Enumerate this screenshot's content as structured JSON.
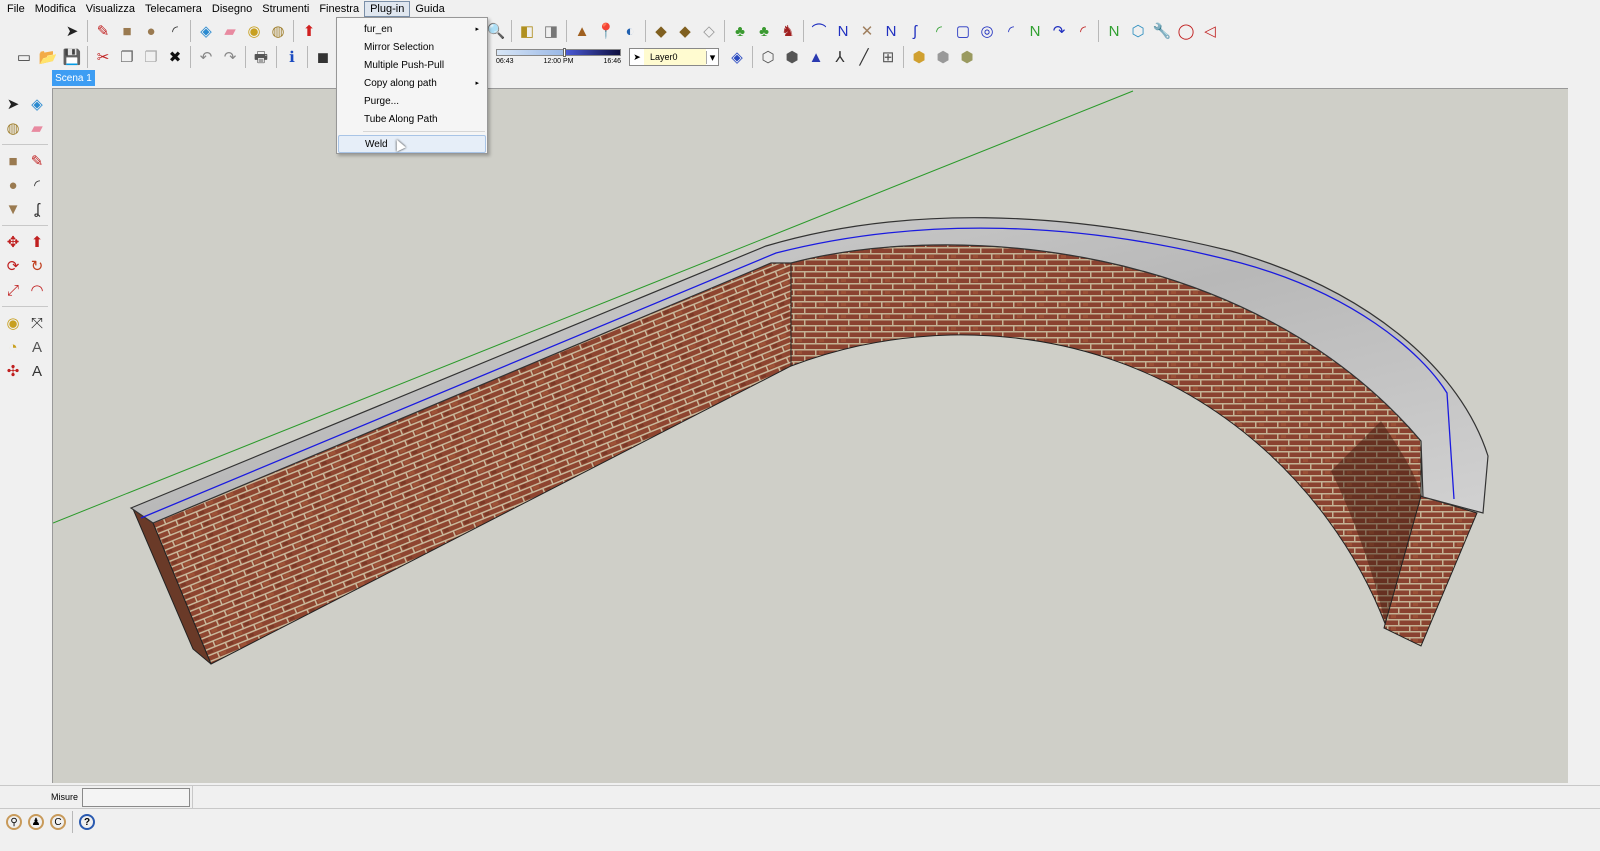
{
  "menubar": {
    "items": [
      "File",
      "Modifica",
      "Visualizza",
      "Telecamera",
      "Disegno",
      "Strumenti",
      "Finestra",
      "Plug-in",
      "Guida"
    ],
    "active": "Plug-in"
  },
  "plugin_menu": {
    "items": [
      {
        "label": "fur_en",
        "submenu": true
      },
      {
        "label": "Mirror Selection",
        "submenu": false
      },
      {
        "label": "Multiple Push-Pull",
        "submenu": false
      },
      {
        "label": "Copy along path",
        "submenu": true
      },
      {
        "label": "Purge...",
        "submenu": false
      },
      {
        "label": "Tube Along Path",
        "submenu": false
      },
      {
        "label": "Weld",
        "submenu": false,
        "hover": true
      }
    ],
    "submenu_arrow": "▸"
  },
  "toolbar1": {
    "icons": [
      {
        "name": "select-icon",
        "glyph": "➤",
        "color": "#222"
      },
      {
        "sep": 1
      },
      {
        "name": "pencil-icon",
        "glyph": "✎",
        "color": "#c02020"
      },
      {
        "name": "rectangle-icon",
        "glyph": "■",
        "color": "#9a7a50"
      },
      {
        "name": "circle-icon",
        "glyph": "●",
        "color": "#9a7a50"
      },
      {
        "name": "arc-icon",
        "glyph": "◜",
        "color": "#333"
      },
      {
        "sep": 1
      },
      {
        "name": "make-component-icon",
        "glyph": "◈",
        "color": "#2a8ad0"
      },
      {
        "name": "eraser-icon",
        "glyph": "▰",
        "color": "#e88aa0"
      },
      {
        "name": "tape-measure-icon",
        "glyph": "◉",
        "color": "#c8a020"
      },
      {
        "name": "paint-bucket-icon",
        "glyph": "◍",
        "color": "#a08030"
      },
      {
        "sep": 1
      },
      {
        "name": "push-pull-icon",
        "glyph": "⬆",
        "color": "#d02020"
      }
    ]
  },
  "toolbar1_right": {
    "icons": [
      {
        "name": "zoom-extents-icon",
        "glyph": "🔍",
        "color": "#335"
      },
      {
        "sep": 1
      },
      {
        "name": "get-models-icon",
        "glyph": "◧",
        "color": "#b09020"
      },
      {
        "name": "share-model-icon",
        "glyph": "◨",
        "color": "#777"
      },
      {
        "sep": 1
      },
      {
        "name": "google-earth-icon",
        "glyph": "▲",
        "color": "#a06020"
      },
      {
        "name": "place-model-icon",
        "glyph": "📍",
        "color": "#c08020"
      },
      {
        "name": "toggle-terrain-icon",
        "glyph": "◐",
        "color": "#2060b0"
      },
      {
        "sep": 1
      },
      {
        "name": "component-icon",
        "glyph": "◆",
        "color": "#806020"
      },
      {
        "name": "group-icon",
        "glyph": "◆",
        "color": "#806020"
      },
      {
        "name": "outliner-icon",
        "glyph": "◇",
        "color": "#999"
      },
      {
        "sep": 1
      },
      {
        "name": "plant-icon",
        "glyph": "♣",
        "color": "#3a9a30"
      },
      {
        "name": "tree-icon",
        "glyph": "♣",
        "color": "#3a9a30"
      },
      {
        "name": "figure-icon",
        "glyph": "♞",
        "color": "#a02020"
      },
      {
        "sep": 1
      },
      {
        "name": "bezier-icon",
        "glyph": "⌒",
        "color": "#2030c0"
      },
      {
        "name": "polyline-icon",
        "glyph": "N",
        "color": "#2030c0"
      },
      {
        "name": "freehand-icon",
        "glyph": "✕",
        "color": "#a08060"
      },
      {
        "name": "spline-icon",
        "glyph": "N",
        "color": "#2030c0"
      },
      {
        "name": "curve-icon",
        "glyph": "ʃ",
        "color": "#2030c0"
      },
      {
        "name": "arc-spline-icon",
        "glyph": "◜",
        "color": "#30a030"
      },
      {
        "name": "rounded-rect-icon",
        "glyph": "▢",
        "color": "#2030c0"
      },
      {
        "name": "spiral-icon",
        "glyph": "◎",
        "color": "#2030c0"
      },
      {
        "name": "curve2-icon",
        "glyph": "◜",
        "color": "#2030c0"
      },
      {
        "name": "zigzag-icon",
        "glyph": "N",
        "color": "#30a030"
      },
      {
        "name": "hook-icon",
        "glyph": "↷",
        "color": "#2030c0"
      },
      {
        "name": "red-arc-icon",
        "glyph": "◜",
        "color": "#c02020"
      },
      {
        "sep": 1
      },
      {
        "name": "green-line-icon",
        "glyph": "N",
        "color": "#30a030"
      },
      {
        "name": "polygon-icon",
        "glyph": "⬡",
        "color": "#3090c0"
      },
      {
        "name": "wrench-icon",
        "glyph": "🔧",
        "color": "#30a030"
      },
      {
        "name": "ellipse-icon",
        "glyph": "◯",
        "color": "#c02020"
      },
      {
        "name": "triangle-icon",
        "glyph": "◁",
        "color": "#c02020"
      }
    ]
  },
  "toolbar2": {
    "icons": [
      {
        "name": "new-icon",
        "glyph": "▭",
        "color": "#444"
      },
      {
        "name": "open-icon",
        "glyph": "📂",
        "color": "#a08030"
      },
      {
        "name": "save-icon",
        "glyph": "💾",
        "color": "#2a4a9a"
      },
      {
        "sep": 1
      },
      {
        "name": "cut-icon",
        "glyph": "✂",
        "color": "#c02020"
      },
      {
        "name": "copy-icon",
        "glyph": "❐",
        "color": "#666"
      },
      {
        "name": "paste-icon",
        "glyph": "❐",
        "color": "#aaa"
      },
      {
        "name": "delete-icon",
        "glyph": "✖",
        "color": "#111"
      },
      {
        "sep": 1
      },
      {
        "name": "undo-icon",
        "glyph": "↶",
        "color": "#888"
      },
      {
        "name": "redo-icon",
        "glyph": "↷",
        "color": "#888"
      },
      {
        "sep": 1
      },
      {
        "name": "print-icon",
        "glyph": "🖶",
        "color": "#555"
      },
      {
        "sep": 1
      },
      {
        "name": "model-info-icon",
        "glyph": "ℹ",
        "color": "#1a4ac0"
      },
      {
        "sep": 1
      },
      {
        "name": "camera-icon",
        "glyph": "◼",
        "color": "#333"
      }
    ]
  },
  "shadow": {
    "start": "06:43",
    "mid": "12:00 PM",
    "end": "16:46",
    "time_fraction": 0.54
  },
  "layer": {
    "name": "Layer0",
    "arrow": "▾"
  },
  "toolbar2_right": {
    "icons": [
      {
        "name": "layer-manager-icon",
        "glyph": "◈",
        "color": "#2a4ac0"
      },
      {
        "sep": 1
      },
      {
        "name": "xray-icon",
        "glyph": "⬡",
        "color": "#555"
      },
      {
        "name": "wireframe-icon",
        "glyph": "⬢",
        "color": "#555"
      },
      {
        "name": "shaded-icon",
        "glyph": "▲",
        "color": "#2a3ab0"
      },
      {
        "name": "axes-icon",
        "glyph": "⅄",
        "color": "#333"
      },
      {
        "name": "section-icon",
        "glyph": "╱",
        "color": "#333"
      },
      {
        "name": "section-plane-icon",
        "glyph": "⊞",
        "color": "#555"
      },
      {
        "sep": 1
      },
      {
        "name": "iso-view-icon",
        "glyph": "⬢",
        "color": "#d0a030"
      },
      {
        "name": "top-view-icon",
        "glyph": "⬢",
        "color": "#999"
      },
      {
        "name": "front-view-icon",
        "glyph": "⬢",
        "color": "#9a9a60"
      }
    ]
  },
  "scene_tab": "Scena 1",
  "left_toolbar": {
    "rows": [
      [
        {
          "name": "select-icon",
          "glyph": "➤",
          "color": "#222"
        },
        {
          "name": "component-icon",
          "glyph": "◈",
          "color": "#2a8ad0"
        }
      ],
      [
        {
          "name": "paint-bucket-icon",
          "glyph": "◍",
          "color": "#a08030"
        },
        {
          "name": "eraser-icon",
          "glyph": "▰",
          "color": "#e88aa0"
        }
      ],
      "sep",
      [
        {
          "name": "rectangle-icon",
          "glyph": "■",
          "color": "#9a7a50"
        },
        {
          "name": "line-icon",
          "glyph": "✎",
          "color": "#c02020"
        }
      ],
      [
        {
          "name": "circle-icon",
          "glyph": "●",
          "color": "#9a7a50"
        },
        {
          "name": "arc-icon",
          "glyph": "◜",
          "color": "#333"
        }
      ],
      [
        {
          "name": "polygon-icon",
          "glyph": "▼",
          "color": "#9a7a50"
        },
        {
          "name": "freehand-icon",
          "glyph": "ʆ",
          "color": "#333"
        }
      ],
      "sep",
      [
        {
          "name": "move-icon",
          "glyph": "✥",
          "color": "#c02020"
        },
        {
          "name": "push-pull-icon",
          "glyph": "⬆",
          "color": "#c02020"
        }
      ],
      [
        {
          "name": "rotate-icon",
          "glyph": "⟳",
          "color": "#c02020"
        },
        {
          "name": "follow-me-icon",
          "glyph": "↻",
          "color": "#c04020"
        }
      ],
      [
        {
          "name": "scale-icon",
          "glyph": "⤢",
          "color": "#c02020"
        },
        {
          "name": "offset-icon",
          "glyph": "◠",
          "color": "#c02020"
        }
      ],
      "sep",
      [
        {
          "name": "tape-measure-icon",
          "glyph": "◉",
          "color": "#c8a020"
        },
        {
          "name": "dimension-icon",
          "glyph": "⤧",
          "color": "#333"
        }
      ],
      [
        {
          "name": "protractor-icon",
          "glyph": "◔",
          "color": "#c8a020"
        },
        {
          "name": "text-icon",
          "glyph": "A",
          "color": "#555"
        }
      ],
      [
        {
          "name": "axes-icon",
          "glyph": "✣",
          "color": "#c02020"
        },
        {
          "name": "3d-text-icon",
          "glyph": "A",
          "color": "#333"
        }
      ]
    ]
  },
  "measure": {
    "label": "Misure",
    "value": ""
  },
  "status_icons": [
    {
      "name": "geo-location-icon",
      "glyph": "⚲"
    },
    {
      "name": "credits-icon",
      "glyph": "♟"
    },
    {
      "name": "copyright-icon",
      "glyph": "C"
    }
  ],
  "help_icon": "?",
  "colors": {
    "viewport": "#cfcfc8",
    "scene_tab": "#3d9df3",
    "brick": "#8a3f2a",
    "cap": "#c9c9c9",
    "axis_green": "#2a9a2a",
    "selection_blue": "#1a1ae0"
  }
}
